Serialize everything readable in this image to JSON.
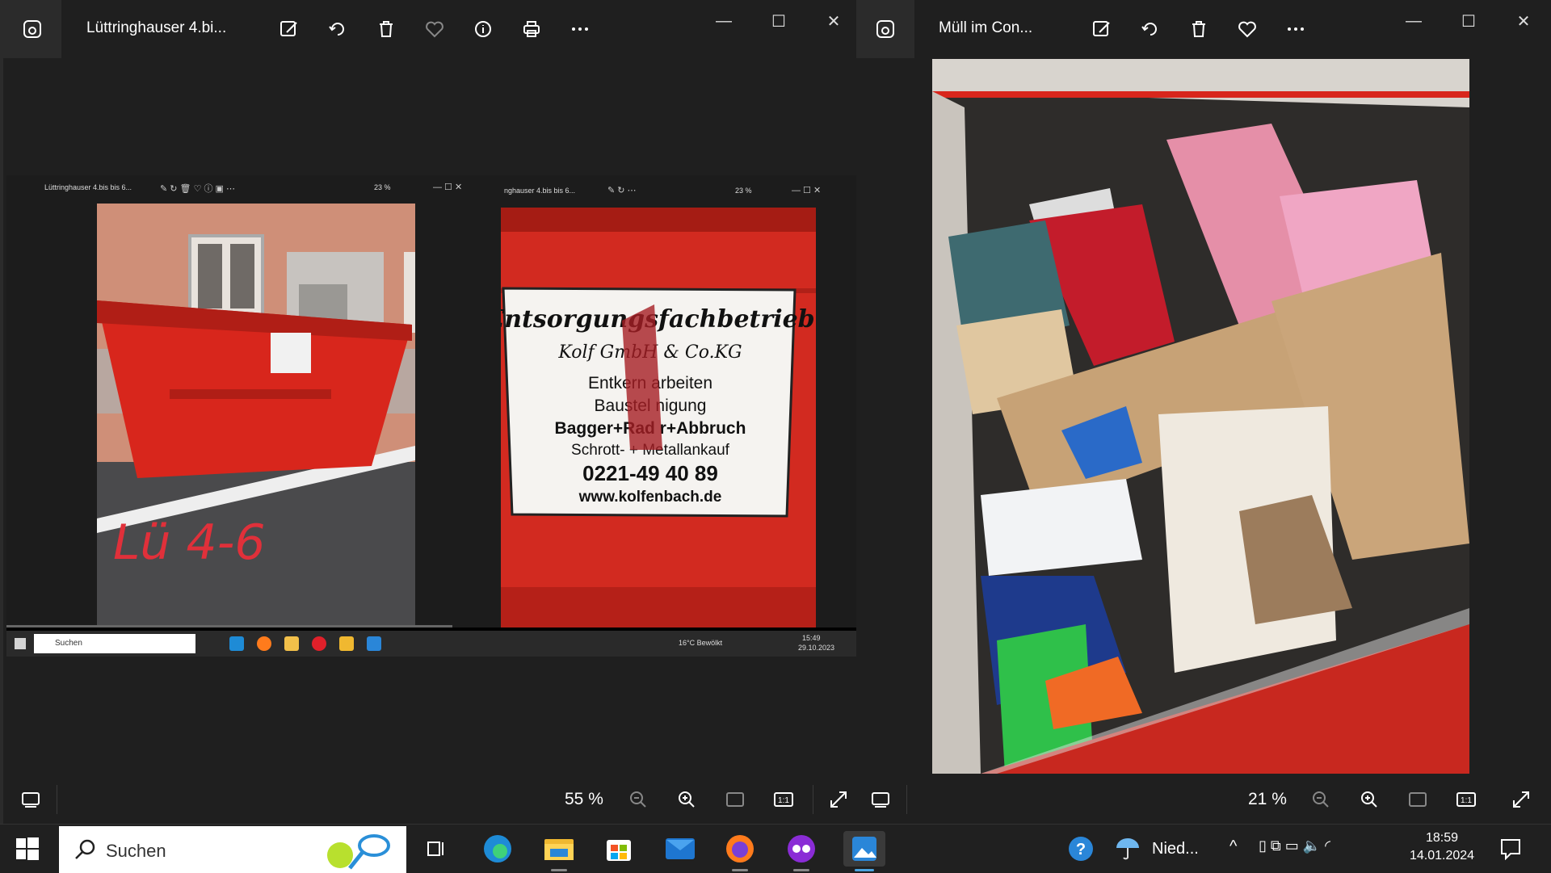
{
  "left_window": {
    "title": "Lüttringhauser 4.bi...",
    "zoom": "55 %",
    "controls": {
      "minimize": "—",
      "maximize": "☐",
      "close": "✕"
    }
  },
  "right_window": {
    "title": "Müll im Con...",
    "zoom": "21 %",
    "controls": {
      "minimize": "—",
      "maximize": "☐",
      "close": "✕"
    }
  },
  "inner_screenshot": {
    "win1_title": "Lüttringhauser 4.bis bis 6...",
    "win1_zoom": "23 %",
    "win2_title": "nghauser 4.bis bis 6...",
    "win2_zoom": "23 %",
    "search": "Suchen",
    "weather": "16°C Bewölkt",
    "time": "15:49",
    "date": "29.10.2023",
    "handwriting": "Lü 4-6",
    "sign_lines": [
      "Entsorgungsfachbetrieb",
      "Kolf      GmbH & Co.KG",
      "Entkern    arbeiten",
      "Baustel   nigung",
      "Bagger+Rad   r+Abbruch",
      "Schrott- + Metallankauf",
      "0221-49 40 89",
      "www.kolfenbach.de"
    ]
  },
  "taskbar": {
    "search": "Suchen",
    "weather": "Nied...",
    "time": "18:59",
    "date": "14.01.2024"
  },
  "colors": {
    "accent": "#4aa3df",
    "container_red": "#d8261c",
    "bg": "#1f1f1f"
  }
}
